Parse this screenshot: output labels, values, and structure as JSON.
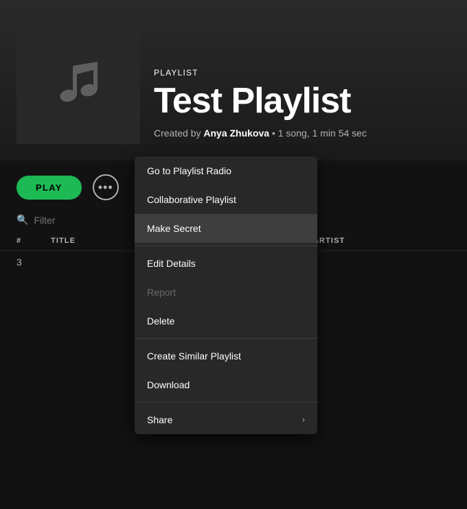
{
  "header": {
    "playlist_label": "PLAYLIST",
    "playlist_title": "Test Playlist",
    "created_by_prefix": "Created by ",
    "creator_name": "Anya Zhukova",
    "meta_suffix": " • 1 song, 1 min 54 sec"
  },
  "controls": {
    "play_label": "PLAY",
    "more_button_dots": "•••"
  },
  "filter": {
    "placeholder": "Filter",
    "search_icon": "🔍"
  },
  "columns": {
    "num": "#",
    "title": "TITLE",
    "artist": "ARTIST"
  },
  "tracks": [
    {
      "num": "3"
    }
  ],
  "context_menu": {
    "items": [
      {
        "id": "go-to-playlist-radio",
        "label": "Go to Playlist Radio",
        "disabled": false,
        "has_arrow": false
      },
      {
        "id": "collaborative-playlist",
        "label": "Collaborative Playlist",
        "disabled": false,
        "has_arrow": false
      },
      {
        "id": "make-secret",
        "label": "Make Secret",
        "disabled": false,
        "has_arrow": false,
        "active": true
      },
      {
        "id": "edit-details",
        "label": "Edit Details",
        "disabled": false,
        "has_arrow": false
      },
      {
        "id": "report",
        "label": "Report",
        "disabled": true,
        "has_arrow": false
      },
      {
        "id": "delete",
        "label": "Delete",
        "disabled": false,
        "has_arrow": false
      },
      {
        "id": "create-similar-playlist",
        "label": "Create Similar Playlist",
        "disabled": false,
        "has_arrow": false
      },
      {
        "id": "download",
        "label": "Download",
        "disabled": false,
        "has_arrow": false
      },
      {
        "id": "share",
        "label": "Share",
        "disabled": false,
        "has_arrow": true,
        "arrow_label": "›"
      }
    ]
  },
  "colors": {
    "green": "#1db954",
    "bg_dark": "#121212",
    "bg_medium": "#282828",
    "bg_hover": "#3e3e3e",
    "text_muted": "#b3b3b3",
    "text_disabled": "#6a6a6a"
  }
}
